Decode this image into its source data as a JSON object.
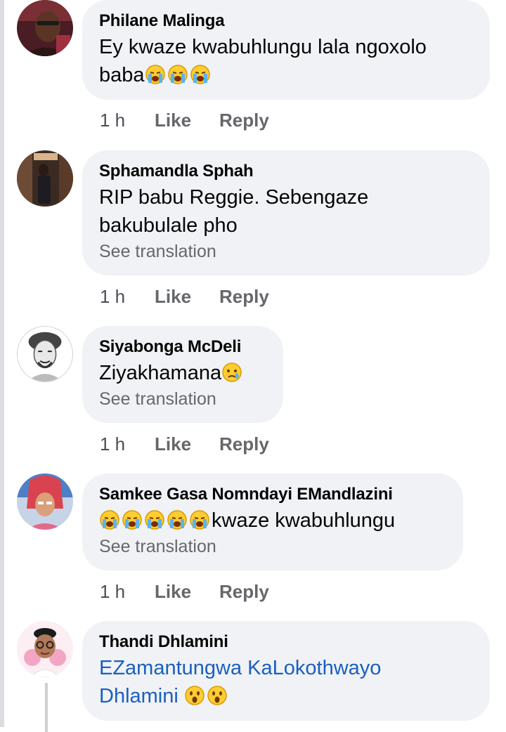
{
  "comments": [
    {
      "author": "Philane Malinga",
      "lines": [
        "Ey kwaze kwabuhlungu lala ngoxolo",
        "baba"
      ],
      "emoji_after": [
        "loudly-crying-face",
        "loudly-crying-face",
        "loudly-crying-face"
      ],
      "see_translation": "",
      "time": "1 h",
      "like": "Like",
      "reply": "Reply"
    },
    {
      "author": "Sphamandla Sphah",
      "lines": [
        "RIP babu Reggie. Sebengaze",
        "bakubulale pho"
      ],
      "see_translation": "See translation",
      "time": "1 h",
      "like": "Like",
      "reply": "Reply"
    },
    {
      "author": "Siyabonga McDeli",
      "lines": [
        "Ziyakhamana"
      ],
      "emoji_after": [
        "crying-face"
      ],
      "see_translation": "See translation",
      "time": "1 h",
      "like": "Like",
      "reply": "Reply"
    },
    {
      "author": "Samkee Gasa Nomndayi EMandlazini",
      "emoji_before": [
        "loudly-crying-face",
        "loudly-crying-face",
        "loudly-crying-face",
        "loudly-crying-face",
        "loudly-crying-face"
      ],
      "lines": [
        "kwaze kwabuhlungu"
      ],
      "see_translation": "See translation",
      "time": "1 h",
      "like": "Like",
      "reply": "Reply"
    },
    {
      "author": "Thandi Dhlamini",
      "lines": [
        "EZamantungwa KaLokothwayo",
        "Dhlamini"
      ],
      "link_text": true,
      "emoji_after": [
        "astonished-face",
        "astonished-face"
      ]
    }
  ],
  "colors": {
    "bubble": "#f0f2f5",
    "secondary_text": "#65676b",
    "link": "#1a5fbf"
  }
}
